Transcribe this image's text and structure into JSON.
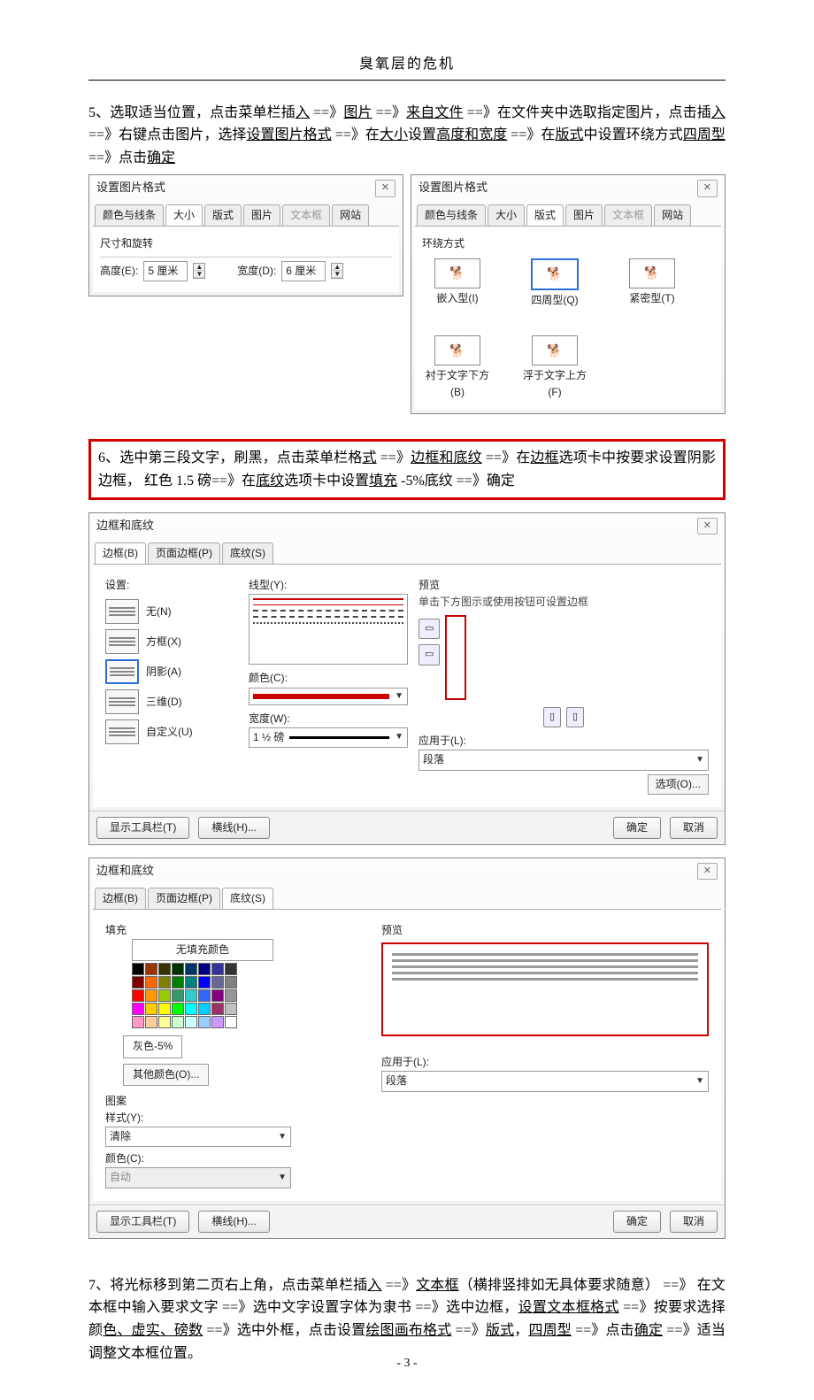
{
  "header": {
    "title": "臭氧层的危机"
  },
  "para5": {
    "prefix": "5、选取适当位置，点击菜单栏插",
    "u1": "入",
    "t1": "   ==》",
    "u2": "图片",
    "t2": " ==》",
    "u3": "来自文件",
    "t3": " ==》在文件夹中选取指定图片，点击插",
    "u4": "入",
    "t4": "  ==》右键点击图片，选择",
    "u5": "设置图片格式",
    "t5": "    ==》在",
    "u6": "大小",
    "t6": "设置",
    "u7": "高度和宽度",
    "t7": " ==》在",
    "u8": "版式",
    "t8": "中设置环绕方式",
    "u9": "四周型",
    "t9": "   ==》点击",
    "u10": "确定"
  },
  "dlg_size": {
    "title": "设置图片格式",
    "tabs": [
      "颜色与线条",
      "大小",
      "版式",
      "图片",
      "文本框",
      "网站"
    ],
    "active_tab": "大小",
    "group": "尺寸和旋转",
    "height_label": "高度(E):",
    "height_value": "5 厘米",
    "width_label": "宽度(D):",
    "width_value": "6 厘米"
  },
  "dlg_layout": {
    "title": "设置图片格式",
    "tabs": [
      "颜色与线条",
      "大小",
      "版式",
      "图片",
      "文本框",
      "网站"
    ],
    "active_tab": "版式",
    "group": "环绕方式",
    "items": [
      {
        "label": "嵌入型(I)"
      },
      {
        "label": "四周型(Q)",
        "sel": true
      },
      {
        "label": "紧密型(T)"
      },
      {
        "label": "衬于文字下方(B)"
      },
      {
        "label": "浮于文字上方(F)"
      }
    ]
  },
  "redbox": {
    "l1a": "6、选中第三段文字，刷黑，点击菜单栏格",
    "l1u1": "式",
    "l1b": "   ==》",
    "l1u2": "边框和底纹",
    "l1c": " ==》在",
    "l1u3": "边框",
    "l1d": "选项卡中按要求设置阴影边框，   红色  1.5  磅==》在",
    "l1u4": "底纹",
    "l1e": "选项卡中设置",
    "l1u5": "填充",
    "l1f": "   -5%底纹 ==》确定"
  },
  "dlg_border": {
    "title": "边框和底纹",
    "tabs": [
      "边框(B)",
      "页面边框(P)",
      "底纹(S)"
    ],
    "active_tab": "边框(B)",
    "settings_label": "设置:",
    "settings": [
      {
        "label": "无(N)"
      },
      {
        "label": "方框(X)"
      },
      {
        "label": "阴影(A)",
        "sel": true
      },
      {
        "label": "三维(D)"
      },
      {
        "label": "自定义(U)"
      }
    ],
    "linestyle_label": "线型(Y):",
    "color_label": "颜色(C):",
    "width_label": "宽度(W):",
    "width_value": "1 ½ 磅",
    "preview_label": "预览",
    "preview_hint": "单击下方图示或使用按钮可设置边框",
    "apply_label": "应用于(L):",
    "apply_value": "段落",
    "options_btn": "选项(O)...",
    "toolbar_btn": "显示工具栏(T)",
    "hline_btn": "横线(H)...",
    "ok": "确定",
    "cancel": "取消"
  },
  "dlg_shading": {
    "title": "边框和底纹",
    "tabs": [
      "边框(B)",
      "页面边框(P)",
      "底纹(S)"
    ],
    "active_tab": "底纹(S)",
    "fill_label": "填充",
    "nofill": "无填充颜色",
    "gray5": "灰色-5%",
    "morecolor": "其他颜色(O)...",
    "pattern_label": "图案",
    "style_label": "样式(Y):",
    "style_value": "清除",
    "color_label": "颜色(C):",
    "color_value": "自动",
    "preview_label": "预览",
    "apply_label": "应用于(L):",
    "apply_value": "段落",
    "toolbar_btn": "显示工具栏(T)",
    "hline_btn": "横线(H)...",
    "ok": "确定",
    "cancel": "取消",
    "palette": [
      [
        "#000000",
        "#993300",
        "#333300",
        "#003300",
        "#003366",
        "#000080",
        "#333399",
        "#333333"
      ],
      [
        "#800000",
        "#ff6600",
        "#808000",
        "#008000",
        "#008080",
        "#0000ff",
        "#666699",
        "#808080"
      ],
      [
        "#ff0000",
        "#ff9900",
        "#99cc00",
        "#339966",
        "#33cccc",
        "#3366ff",
        "#800080",
        "#969696"
      ],
      [
        "#ff00ff",
        "#ffcc00",
        "#ffff00",
        "#00ff00",
        "#00ffff",
        "#00ccff",
        "#993366",
        "#c0c0c0"
      ],
      [
        "#ff99cc",
        "#ffcc99",
        "#ffff99",
        "#ccffcc",
        "#ccffff",
        "#99ccff",
        "#cc99ff",
        "#ffffff"
      ]
    ]
  },
  "para7": {
    "a": "7、将光标移到第二页右上角，点击菜单栏插",
    "u1": "入",
    "b": "     ==》",
    "u2": "文本框",
    "c": "（横排竖排如无具体要求随意）  ==》 在文本框中输入要求文字    ==》选中文字设置字体为隶书    ==》选中边框，",
    "u3": "设置文本框格式",
    "d": "  ==》按要求选择颜",
    "u4": "色、虚实、磅数",
    "e": "    ==》选中外框，点击设置",
    "u5": "绘图画布格式",
    "f": "  ==》",
    "u6": "版式",
    "g": "，",
    "u7": "四周型",
    "h": "  ==》点击",
    "u8": "确定",
    "i": " ==》适当调整文本框位置。"
  },
  "page_num": "- 3 -"
}
